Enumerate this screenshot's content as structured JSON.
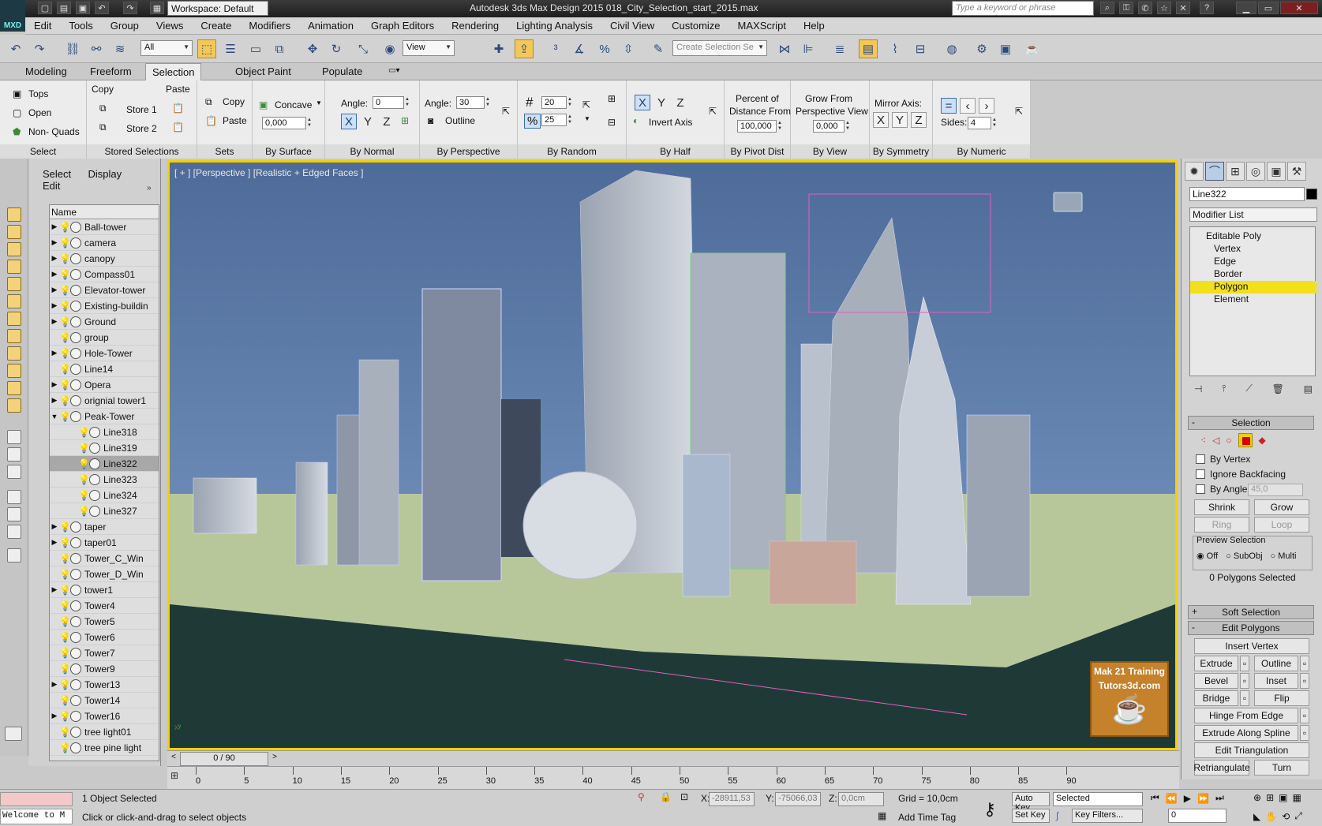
{
  "app": {
    "title": "Autodesk 3ds Max Design 2015     018_City_Selection_start_2015.max",
    "logo_text": "MXD",
    "workspace": "Workspace: Default",
    "search_placeholder": "Type a keyword or phrase"
  },
  "menu": [
    "Edit",
    "Tools",
    "Group",
    "Views",
    "Create",
    "Modifiers",
    "Animation",
    "Graph Editors",
    "Rendering",
    "Lighting Analysis",
    "Civil View",
    "Customize",
    "MAXScript",
    "Help"
  ],
  "toolbar": {
    "selection_filter": "All",
    "ref_coord": "View",
    "named_selection_placeholder": "Create Selection Se"
  },
  "ribbon_tabs": [
    {
      "label": "Modeling",
      "active": false
    },
    {
      "label": "Freeform",
      "active": false
    },
    {
      "label": "Selection",
      "active": true
    },
    {
      "label": "Object Paint",
      "active": false
    },
    {
      "label": "Populate",
      "active": false
    }
  ],
  "ribbon": {
    "select": {
      "label": "Select",
      "tops": "Tops",
      "open": "Open",
      "non_quads": "Non- Quads"
    },
    "stored": {
      "label": "Stored Selections",
      "copy": "Copy",
      "paste": "Paste",
      "store1": "Store 1",
      "store2": "Store 2"
    },
    "sets": {
      "label": "Sets",
      "copy": "Copy",
      "paste": "Paste"
    },
    "surface": {
      "label": "By Surface",
      "mode": "Concave",
      "value": "0,000"
    },
    "normal": {
      "label": "By Normal",
      "angle_label": "Angle:",
      "angle": "0",
      "x": "X",
      "y": "Y",
      "z": "Z"
    },
    "perspective": {
      "label": "By Perspective",
      "angle_label": "Angle:",
      "angle": "30",
      "outline": "Outline"
    },
    "random": {
      "label": "By Random",
      "count": "20",
      "percent": "25",
      "hash": "#",
      "pct": "%"
    },
    "half": {
      "label": "By Half",
      "x": "X",
      "y": "Y",
      "z": "Z",
      "invert": "Invert Axis"
    },
    "pivot": {
      "label": "By Pivot Dist",
      "line1": "Percent of",
      "line2": "Distance From",
      "value": "100,000"
    },
    "view": {
      "label": "By View",
      "line1": "Grow From",
      "line2": "Perspective View",
      "value": "0,000"
    },
    "symmetry": {
      "label": "By Symmetry",
      "mirror": "Mirror Axis:",
      "x": "X",
      "y": "Y",
      "z": "Z"
    },
    "numeric": {
      "label": "By Numeric",
      "sides_label": "Sides:",
      "sides": "4"
    }
  },
  "scene_explorer": {
    "menu": [
      "Select",
      "Display",
      "Edit"
    ],
    "column": "Name",
    "rows": [
      {
        "name": "Ball-tower",
        "exp": "▶",
        "child": false,
        "sel": false
      },
      {
        "name": "camera",
        "exp": "▶",
        "child": false,
        "sel": false
      },
      {
        "name": "canopy",
        "exp": "▶",
        "child": false,
        "sel": false
      },
      {
        "name": "Compass01",
        "exp": "▶",
        "child": false,
        "sel": false
      },
      {
        "name": "Elevator-tower",
        "exp": "▶",
        "child": false,
        "sel": false
      },
      {
        "name": "Existing-buildin",
        "exp": "▶",
        "child": false,
        "sel": false
      },
      {
        "name": "Ground",
        "exp": "▶",
        "child": false,
        "sel": false
      },
      {
        "name": "group",
        "exp": "",
        "child": false,
        "sel": false
      },
      {
        "name": "Hole-Tower",
        "exp": "▶",
        "child": false,
        "sel": false
      },
      {
        "name": "Line14",
        "exp": "",
        "child": false,
        "sel": false
      },
      {
        "name": "Opera",
        "exp": "▶",
        "child": false,
        "sel": false
      },
      {
        "name": "orignial tower1",
        "exp": "▶",
        "child": false,
        "sel": false
      },
      {
        "name": "Peak-Tower",
        "exp": "▼",
        "child": false,
        "sel": false
      },
      {
        "name": "Line318",
        "exp": "",
        "child": true,
        "sel": false
      },
      {
        "name": "Line319",
        "exp": "",
        "child": true,
        "sel": false
      },
      {
        "name": "Line322",
        "exp": "",
        "child": true,
        "sel": true
      },
      {
        "name": "Line323",
        "exp": "",
        "child": true,
        "sel": false
      },
      {
        "name": "Line324",
        "exp": "",
        "child": true,
        "sel": false
      },
      {
        "name": "Line327",
        "exp": "",
        "child": true,
        "sel": false
      },
      {
        "name": "taper",
        "exp": "▶",
        "child": false,
        "sel": false
      },
      {
        "name": "taper01",
        "exp": "▶",
        "child": false,
        "sel": false
      },
      {
        "name": "Tower_C_Win",
        "exp": "",
        "child": false,
        "sel": false
      },
      {
        "name": "Tower_D_Win",
        "exp": "",
        "child": false,
        "sel": false
      },
      {
        "name": "tower1",
        "exp": "▶",
        "child": false,
        "sel": false
      },
      {
        "name": "Tower4",
        "exp": "",
        "child": false,
        "sel": false
      },
      {
        "name": "Tower5",
        "exp": "",
        "child": false,
        "sel": false
      },
      {
        "name": "Tower6",
        "exp": "",
        "child": false,
        "sel": false
      },
      {
        "name": "Tower7",
        "exp": "",
        "child": false,
        "sel": false
      },
      {
        "name": "Tower9",
        "exp": "",
        "child": false,
        "sel": false
      },
      {
        "name": "Tower13",
        "exp": "▶",
        "child": false,
        "sel": false
      },
      {
        "name": "Tower14",
        "exp": "",
        "child": false,
        "sel": false
      },
      {
        "name": "Tower16",
        "exp": "▶",
        "child": false,
        "sel": false
      },
      {
        "name": "tree light01",
        "exp": "",
        "child": false,
        "sel": false
      },
      {
        "name": "tree pine light",
        "exp": "",
        "child": false,
        "sel": false
      }
    ]
  },
  "viewport": {
    "label": "[ + ] [Perspective ] [Realistic + Edged Faces ]",
    "badge_line1": "Mak 21 Training",
    "badge_line2": "Tutors3d.com"
  },
  "command_panel": {
    "object_name": "Line322",
    "modifier_list": "Modifier List",
    "stack": [
      {
        "label": "Editable Poly",
        "level": 0,
        "sel": false
      },
      {
        "label": "Vertex",
        "level": 1,
        "sel": false
      },
      {
        "label": "Edge",
        "level": 1,
        "sel": false
      },
      {
        "label": "Border",
        "level": 1,
        "sel": false
      },
      {
        "label": "Polygon",
        "level": 1,
        "sel": true
      },
      {
        "label": "Element",
        "level": 1,
        "sel": false
      }
    ],
    "selection_title": "Selection",
    "by_vertex": "By Vertex",
    "ignore_backfacing": "Ignore Backfacing",
    "by_angle": "By Angle:",
    "by_angle_value": "45,0",
    "shrink": "Shrink",
    "grow": "Grow",
    "ring": "Ring",
    "loop": "Loop",
    "preview_title": "Preview Selection",
    "preview_off": "Off",
    "preview_subobj": "SubObj",
    "preview_multi": "Multi",
    "polys_selected": "0 Polygons Selected",
    "soft_selection": "Soft Selection",
    "edit_polygons": "Edit Polygons",
    "insert_vertex": "Insert Vertex",
    "extrude": "Extrude",
    "outline": "Outline",
    "bevel": "Bevel",
    "inset": "Inset",
    "bridge": "Bridge",
    "flip": "Flip",
    "hinge": "Hinge From Edge",
    "extrude_spline": "Extrude Along Spline",
    "edit_tri": "Edit Triangulation",
    "retriangulate": "Retriangulate",
    "turn": "Turn"
  },
  "timeline": {
    "frame_display": "0 / 90",
    "ticks": [
      "0",
      "5",
      "10",
      "15",
      "20",
      "25",
      "30",
      "35",
      "40",
      "45",
      "50",
      "55",
      "60",
      "65",
      "70",
      "75",
      "80",
      "85",
      "90"
    ]
  },
  "status": {
    "selected": "1 Object Selected",
    "prompt": "Click or click-and-drag to select objects",
    "maxscript": "Welcome to M",
    "x_label": "X:",
    "x_value": "-28911,53",
    "y_label": "Y:",
    "y_value": "-75066,03",
    "z_label": "Z:",
    "z_value": "0,0cm",
    "grid": "Grid = 10,0cm",
    "auto_key": "Auto Key",
    "set_key": "Set Key",
    "key_mode": "Selected",
    "key_filters": "Key Filters...",
    "add_time_tag": "Add Time Tag",
    "frame": "0"
  }
}
